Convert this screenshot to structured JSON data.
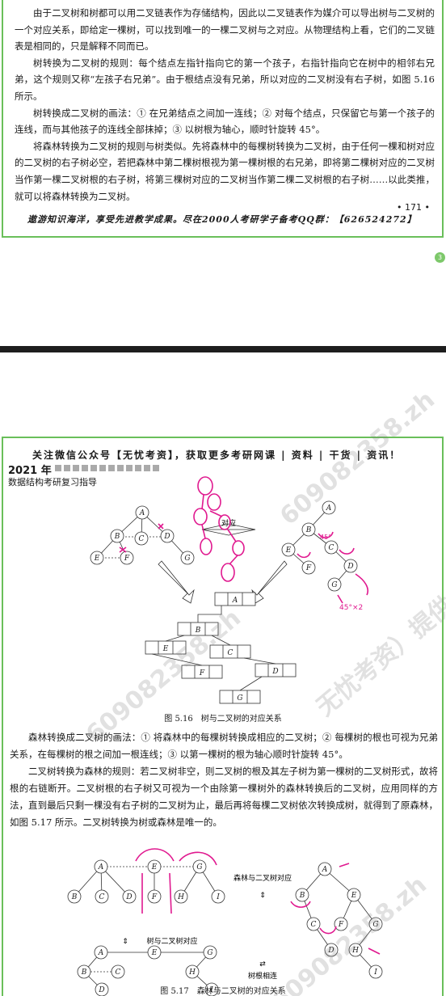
{
  "page1": {
    "para1": "由于二叉树和树都可以用二叉链表作为存储结构，因此以二叉链表作为媒介可以导出树与二叉树的一个对应关系，即给定一棵树，可以找到唯一的一棵二叉树与之对应。从物理结构上看，它们的二叉链表是相同的，只是解释不同而已。",
    "para2": "树转换为二叉树的规则：每个结点左指针指向它的第一个孩子，右指针指向它在树中的相邻右兄弟，这个规则又称“左孩子右兄弟”。由于根结点没有兄弟，所以对应的二叉树没有右子树，如图 5.16 所示。",
    "para3": "树转换成二叉树的画法：① 在兄弟结点之间加一连线；② 对每个结点，只保留它与第一个孩子的连线，而与其他孩子的连线全部抹掉；③ 以树根为轴心，顺时针旋转 45°。",
    "para4": "将森林转换为二叉树的规则与树类似。先将森林中的每棵树转换为二叉树，由于任何一棵和树对应的二叉树的右子树必空，若把森林中第二棵树根视为第一棵树根的右兄弟，即将第二棵树对应的二叉树当作第一棵二叉树根的右子树，将第三棵树对应的二叉树当作第二棵二叉树根的右子树……以此类推，就可以将森林转换为二叉树。",
    "page_number": "• 171 •",
    "footer": "遨游知识海洋，享受先进教学成果。尽在2000人考研学子备考QQ群：【626524272】",
    "badge": "3"
  },
  "page2": {
    "header": "关注微信公众号【无忧考资】，获取更多考研网课 | 资料 | 干货 | 资讯！",
    "year": "2021 年",
    "subtitle": "数据结构考研复习指导",
    "fig1_caption": "图 5.16　树与二叉树的对应关系",
    "fig1_center_label": "对应",
    "para1": "森林转换成二叉树的画法：① 将森林中的每棵树转换成相应的二叉树；② 每棵树的根也可视为兄弟关系，在每棵树的根之间加一根连线；③ 以第一棵树的根为轴心顺时针旋转 45°。",
    "para2": "二叉树转换为森林的规则：若二叉树非空，则二叉树的根及其左子树为第一棵树的二叉树形式，故将根的右链断开。二叉树根的右子树又可视为一个由除第一棵树外的森林转换后的二叉树，应用同样的方法，直到最后只剩一棵没有右子树的二叉树为止，最后再将每棵二叉树依次转换成树，就得到了原森林，如图 5.17 所示。二叉树转换为树或森林是唯一的。",
    "fig2_label_a": "森林与二叉树对应",
    "fig2_label_b": "树与二叉树对应",
    "fig2_label_c": "树根相连",
    "fig2_caption": "图 5.17　森林与二叉树的对应关系",
    "annotation_45": "45°",
    "annotation_45x2": "45°×2"
  },
  "watermarks": [
    "609082358.zh",
    "609082358.zh",
    "609082358.zh",
    "无忧考资）提供"
  ],
  "node_labels": [
    "A",
    "B",
    "C",
    "D",
    "E",
    "F",
    "G",
    "H",
    "I"
  ]
}
